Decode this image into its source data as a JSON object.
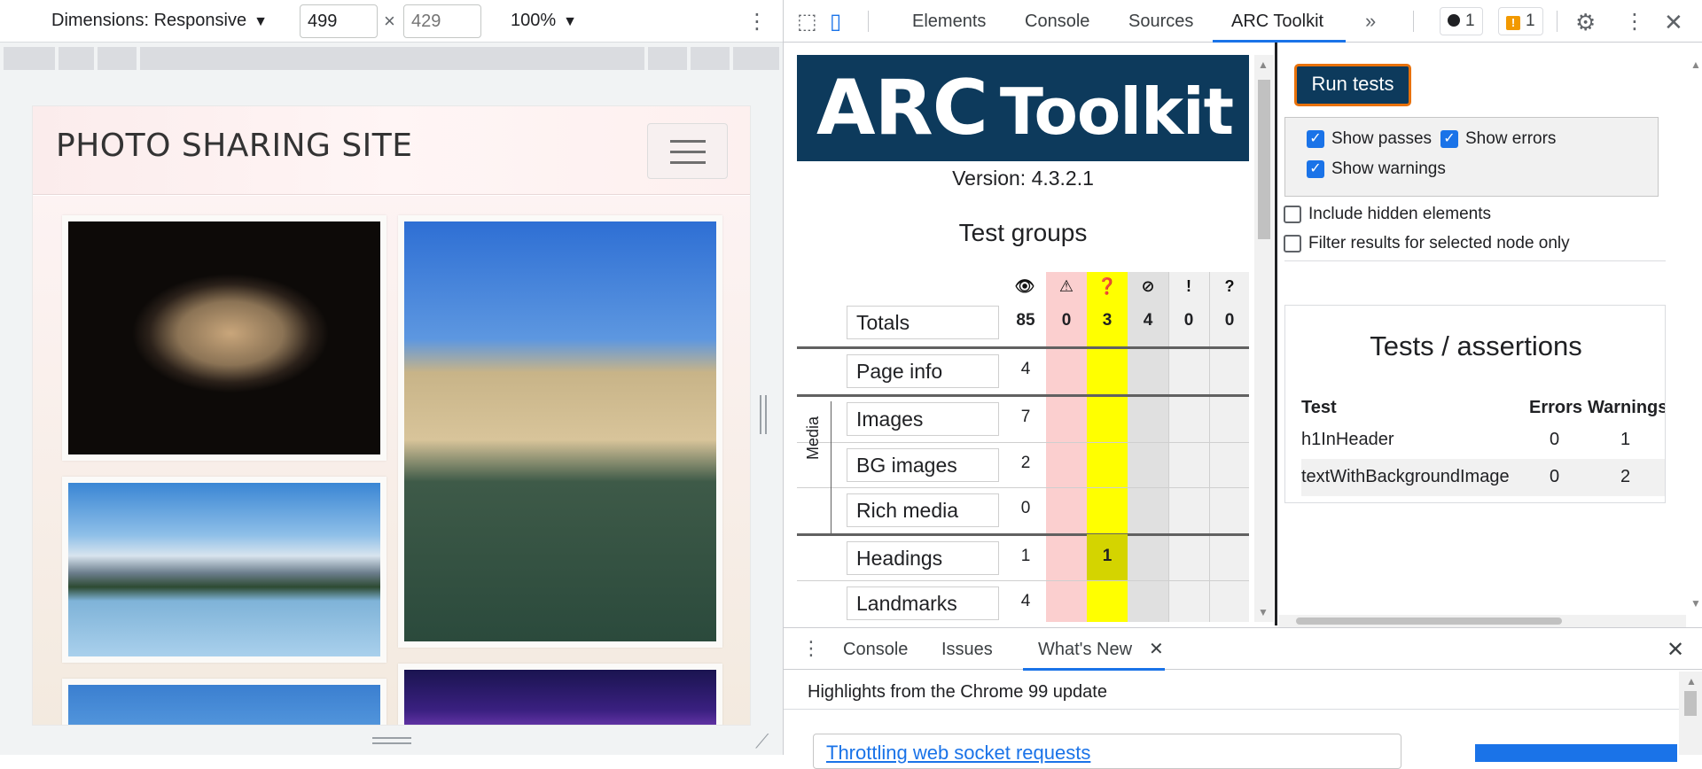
{
  "device_toolbar": {
    "dimensions_label": "Dimensions: Responsive",
    "width": "499",
    "height_placeholder": "429",
    "times": "×",
    "zoom": "100%",
    "caret": "▼",
    "kebab": "⋮"
  },
  "site": {
    "title": "PHOTO SHARING SITE"
  },
  "devtools": {
    "tabs": [
      "Elements",
      "Console",
      "Sources",
      "ARC Toolkit"
    ],
    "more_tabs": "»",
    "errors_count": "1",
    "warnings_count": "1",
    "warn_glyph": "!",
    "gear": "⚙",
    "kebab": "⋮",
    "close": "✕"
  },
  "arc": {
    "logo_text": "AR",
    "logo_c": "C",
    "logo_sub": "Toolkit",
    "version": "Version: 4.3.2.1",
    "groups_title": "Test groups",
    "header_icons": [
      "👁",
      "⚠",
      "❓",
      "⊘",
      "!",
      "?"
    ],
    "totals": {
      "label": "Totals",
      "count": "85",
      "warn": "0",
      "q": "3",
      "hidden": "4",
      "err": "0",
      "unk": "0"
    },
    "rows": [
      {
        "label": "Page info",
        "count": "4"
      },
      {
        "label": "Images",
        "count": "7"
      },
      {
        "label": "BG images",
        "count": "2"
      },
      {
        "label": "Rich media",
        "count": "0"
      },
      {
        "label": "Headings",
        "count": "1",
        "q": "1"
      },
      {
        "label": "Landmarks",
        "count": "4"
      }
    ],
    "media_label": "Media",
    "run_tests": "Run tests",
    "options": {
      "show_passes": "Show passes",
      "show_errors": "Show errors",
      "show_warnings": "Show warnings",
      "include_hidden": "Include hidden elements",
      "filter_selected": "Filter results for selected node only",
      "check": "✓"
    },
    "tests": {
      "title": "Tests / assertions",
      "headers": {
        "test": "Test",
        "errors": "Errors",
        "warnings": "Warnings"
      },
      "rows": [
        {
          "test": "h1InHeader",
          "errors": "0",
          "warnings": "1"
        },
        {
          "test": "textWithBackgroundImage",
          "errors": "0",
          "warnings": "2"
        }
      ]
    }
  },
  "drawer": {
    "tabs": [
      "Console",
      "Issues",
      "What's New"
    ],
    "heading": "Highlights from the Chrome 99 update",
    "card_title": "Throttling web socket requests",
    "close": "✕",
    "kebab": "⋮"
  },
  "colors": {
    "accent": "#1a73e8",
    "arc_navy": "#0d3a5c",
    "run_border": "#e8710a",
    "warn_col": "#fbcfcf",
    "question_col": "#ffff00"
  }
}
